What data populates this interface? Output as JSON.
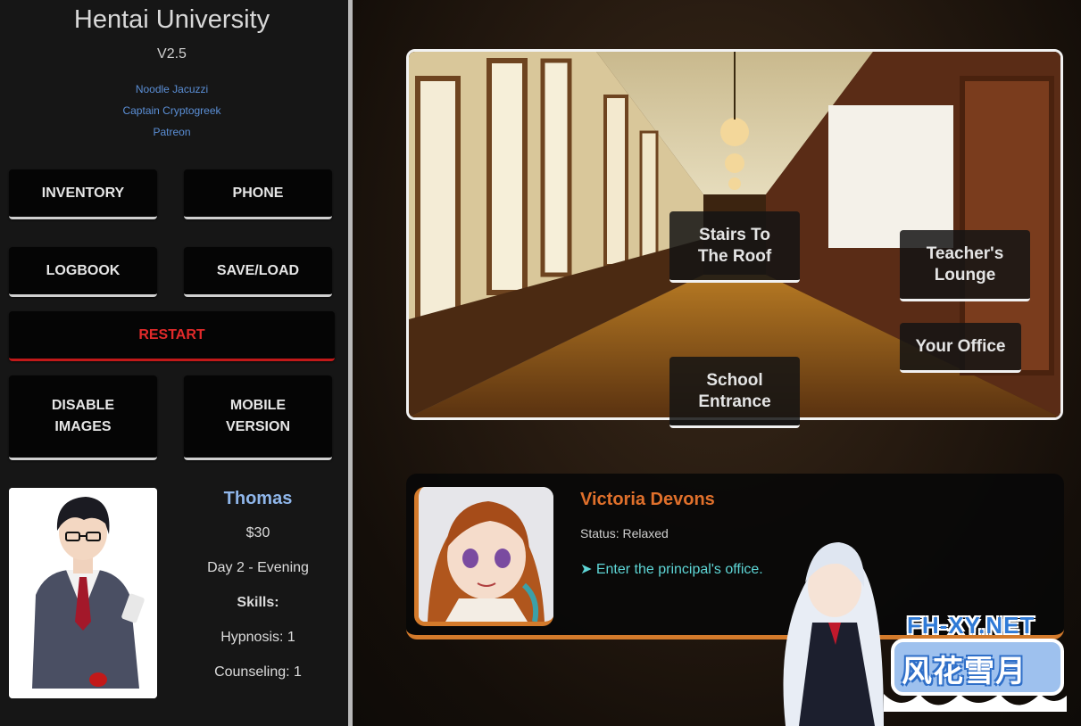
{
  "game": {
    "title": "Hentai University",
    "version": "V2.5",
    "credits": [
      "Noodle Jacuzzi",
      "Captain Cryptogreek",
      "Patreon"
    ]
  },
  "menu": {
    "inventory": "INVENTORY",
    "phone": "PHONE",
    "logbook": "LOGBOOK",
    "save_load": "SAVE/LOAD",
    "restart": "RESTART",
    "disable_images": "DISABLE\nIMAGES",
    "mobile_version": "MOBILE\nVERSION"
  },
  "player": {
    "name": "Thomas",
    "money": "$30",
    "time": "Day 2 - Evening",
    "skills_label": "Skills:",
    "skills": [
      "Hypnosis: 1",
      "Counseling: 1"
    ]
  },
  "locations": {
    "stairs": "Stairs To\nThe Roof",
    "lounge": "Teacher's\nLounge",
    "office": "Your Office",
    "entrance": "School\nEntrance"
  },
  "npc": {
    "name": "Victoria Devons",
    "status": "Status: Relaxed",
    "action": "➤ Enter the principal's office."
  },
  "watermark": {
    "site": "FH-XY.NET",
    "title": "风花雪月"
  },
  "colors": {
    "accent_orange": "#d37a2b",
    "link_blue": "#5b8fd6",
    "restart_red": "#e12a2a",
    "action_cyan": "#5ed6d6"
  }
}
